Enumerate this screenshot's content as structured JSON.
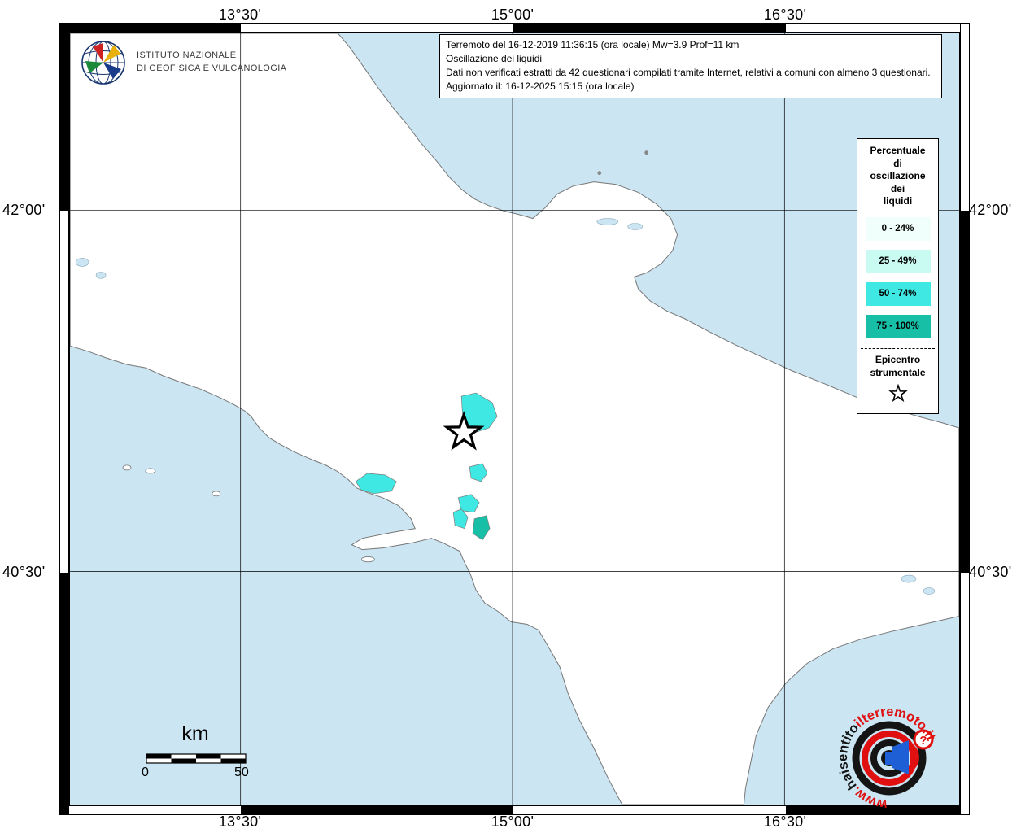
{
  "ingv": {
    "line1": "ISTITUTO NAZIONALE",
    "line2": "DI GEOFISICA E VULCANOLOGIA"
  },
  "info_box": {
    "line1": "Terremoto del 16-12-2019 11:36:15 (ora locale) Mw=3.9 Prof=11 km",
    "line2": "Oscillazione dei liquidi",
    "line3": "Dati non verificati estratti da 42 questionari compilati tramite Internet, relativi a comuni con almeno 3 questionari.",
    "line4": "Aggiornato il: 16-12-2025 15:15 (ora locale)"
  },
  "legend": {
    "title_lines": [
      "Percentuale",
      "di",
      "oscillazione",
      "dei",
      "liquidi"
    ],
    "classes": [
      {
        "label": "0 - 24%",
        "color": "#F0FFFB"
      },
      {
        "label": "25 - 49%",
        "color": "#C9FBF2"
      },
      {
        "label": "50 - 74%",
        "color": "#3FE8E3"
      },
      {
        "label": "75 - 100%",
        "color": "#17BFA6"
      }
    ],
    "epicenter_lines": [
      "Epicentro",
      "strumentale"
    ]
  },
  "axes": {
    "top": [
      "13°30'",
      "15°00'",
      "16°30'"
    ],
    "bottom": [
      "13°30'",
      "15°00'",
      "16°30'"
    ],
    "left": [
      "42°00'",
      "40°30'"
    ],
    "right": [
      "42°00'",
      "40°30'"
    ]
  },
  "scale_bar": {
    "unit": "km",
    "start": "0",
    "end": "50"
  },
  "watermark": {
    "www": "www.",
    "black": "haisentito",
    "red": "ilterremoto.it",
    "question": "?"
  },
  "map": {
    "sea_color": "#CBE5F2",
    "land_color": "#FFFFFF",
    "boundary_color": "#A9A9A9",
    "coast_color": "#777777"
  }
}
